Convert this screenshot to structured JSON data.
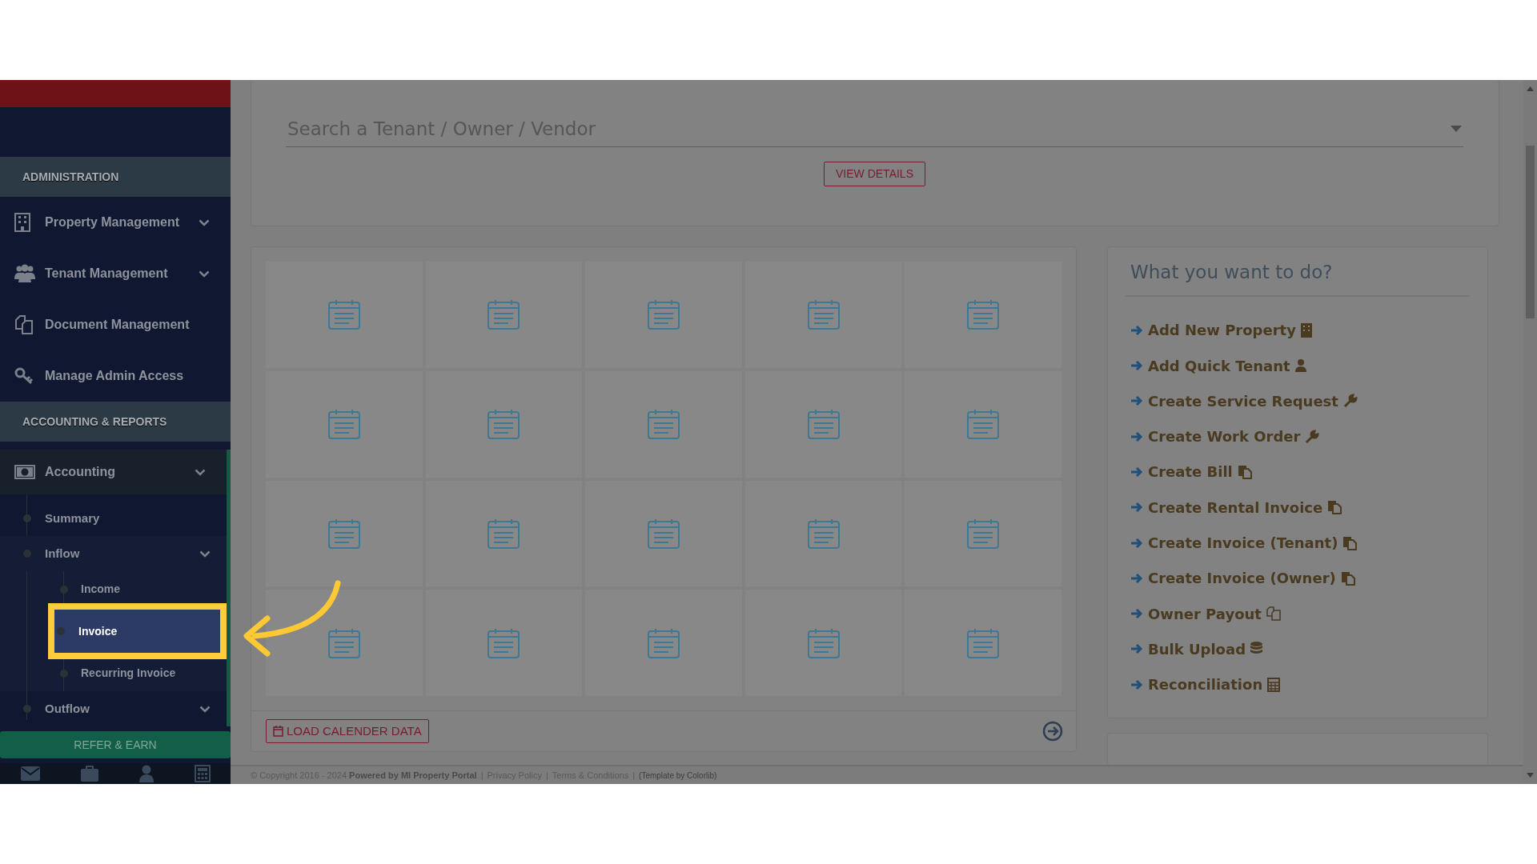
{
  "sidebar": {
    "sections": [
      {
        "title": "ADMINISTRATION",
        "items": [
          {
            "label": "Property Management",
            "submenu": true,
            "active": false
          },
          {
            "label": "Tenant Management",
            "submenu": true,
            "active": false
          },
          {
            "label": "Document Management",
            "submenu": false,
            "active": false
          },
          {
            "label": "Manage Admin Access",
            "submenu": false,
            "active": false
          }
        ]
      },
      {
        "title": "ACCOUNTING & REPORTS",
        "items": [
          {
            "label": "Accounting",
            "submenu": true,
            "active": true,
            "children": [
              {
                "label": "Summary",
                "submenu": false,
                "selected": false
              },
              {
                "label": "Inflow",
                "submenu": true,
                "selected": true,
                "children": [
                  {
                    "label": "Income",
                    "selected": false
                  },
                  {
                    "label": "Invoice",
                    "selected": true
                  },
                  {
                    "label": "Recurring Invoice",
                    "selected": false
                  }
                ]
              },
              {
                "label": "Outflow",
                "submenu": true,
                "selected": false
              }
            ]
          }
        ]
      }
    ],
    "refer_button": "REFER & EARN"
  },
  "search": {
    "placeholder": "Search a Tenant / Owner / Vendor",
    "button": "VIEW DETAILS"
  },
  "calendar": {
    "load_button": "LOAD CALENDER DATA"
  },
  "quick_actions": {
    "title": "What you want to do?",
    "items": [
      "Add New Property",
      "Add Quick Tenant",
      "Create Service Request",
      "Create Work Order",
      "Create Bill",
      "Create Rental Invoice",
      "Create Invoice (Tenant)",
      "Create Invoice (Owner)",
      "Owner Payout",
      "Bulk Upload",
      "Reconciliation"
    ]
  },
  "footer": {
    "copyright": "© Copyright 2016 - 2024 **Powered by MI Property Portal**",
    "separators": [
      "|",
      "|",
      "|"
    ],
    "links": [
      "Privacy Policy",
      "Terms & Conditions"
    ],
    "credit": "(Template by Colorlib)"
  }
}
